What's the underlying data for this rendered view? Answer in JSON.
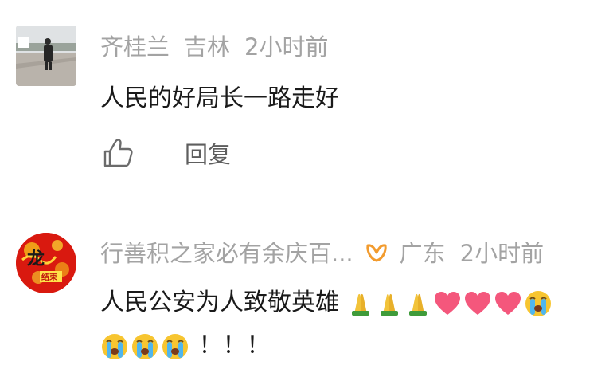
{
  "comments": [
    {
      "author": "齐桂兰",
      "location": "吉林",
      "time": "2小时前",
      "text": "人民的好局长一路走好",
      "reply_label": "回复",
      "avatar_icon": "photo-avatar"
    },
    {
      "author": "行善积之家必有余庆百...",
      "location": "广东",
      "time": "2小时前",
      "text": "人民公安为人致敬英雄",
      "badge_icon": "orange-v-badge-icon",
      "avatar_icon": "red-dragon-logo-avatar",
      "emoji_line1": [
        "folded-hands",
        "folded-hands",
        "folded-hands",
        "red-heart",
        "red-heart",
        "red-heart",
        "crying-face"
      ],
      "emoji_line2": [
        "crying-face",
        "crying-face",
        "crying-face"
      ],
      "trailing_text": "！！！"
    }
  ],
  "colors": {
    "meta_gray": "#a3a3a3",
    "text": "#1a1a1a",
    "badge_orange": "#f29b2e",
    "heart": "#f4577c"
  }
}
